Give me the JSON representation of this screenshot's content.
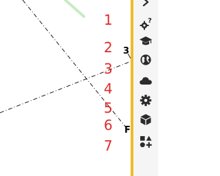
{
  "canvas": {
    "row_numbers": [
      "1",
      "2",
      "3",
      "4",
      "5",
      "6",
      "7"
    ],
    "points": {
      "b": "3",
      "f": "F"
    }
  },
  "sidebar": {
    "tools": [
      {
        "icon": "chevron-right-icon"
      },
      {
        "icon": "help-gears-icon"
      },
      {
        "icon": "graduation-cap-icon"
      },
      {
        "icon": "globe-icon"
      },
      {
        "icon": "cloud-icon"
      },
      {
        "icon": "gear-icon"
      },
      {
        "icon": "cube-icon"
      },
      {
        "icon": "shapes-plus-icon"
      }
    ]
  },
  "colors": {
    "divider": "#f0b928",
    "row_numbers": "#e02a2a",
    "icons": "#2b2b2b",
    "highlight": "#c8ebc4"
  }
}
